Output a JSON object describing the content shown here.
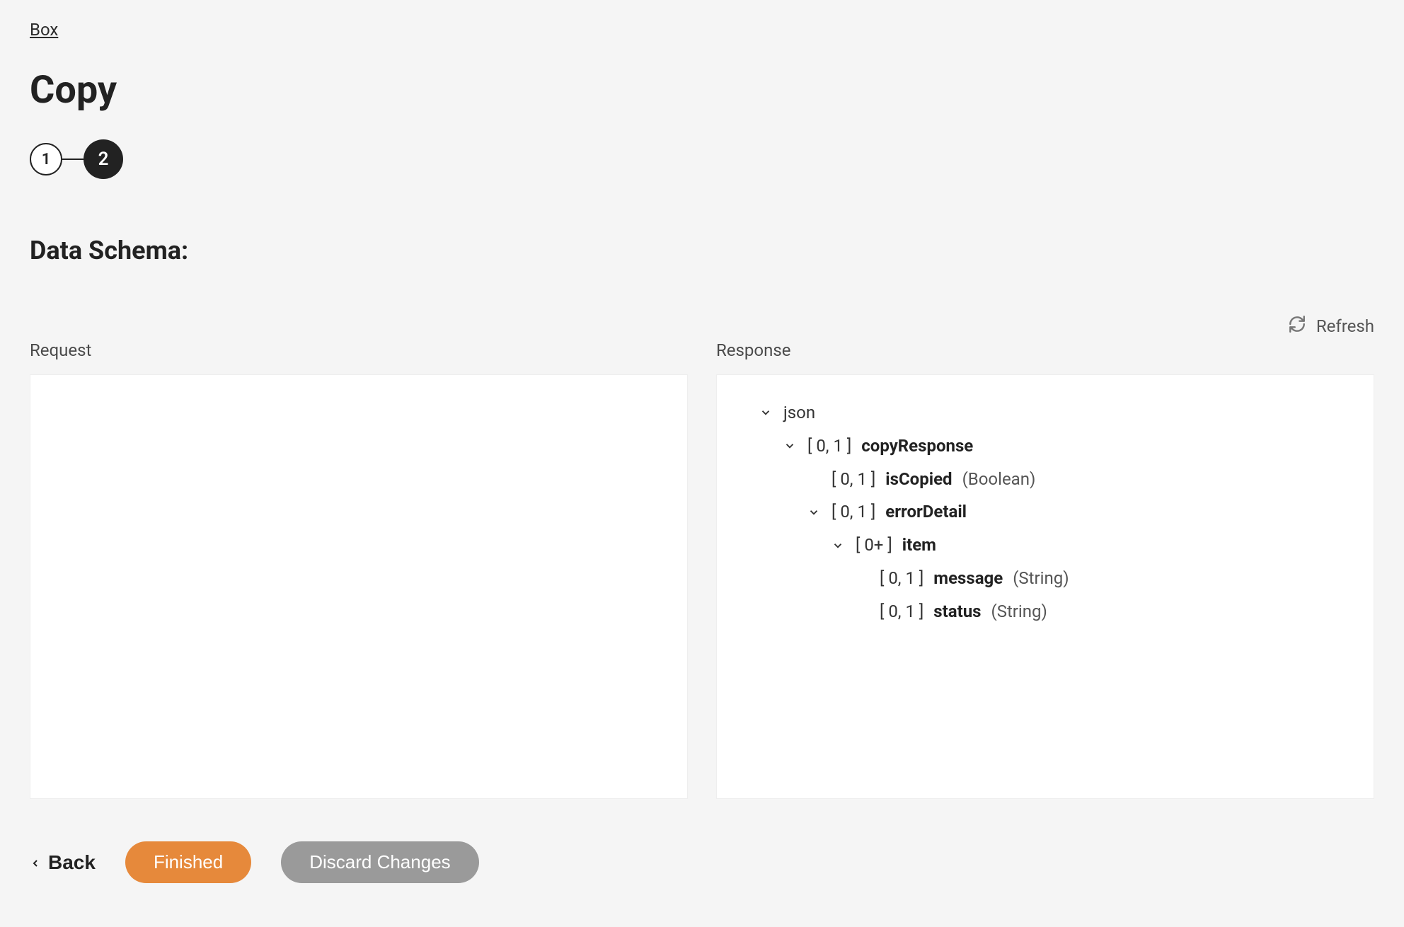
{
  "breadcrumb": {
    "root": "Box"
  },
  "page": {
    "title": "Copy"
  },
  "stepper": {
    "steps": [
      "1",
      "2"
    ],
    "activeIndex": 1
  },
  "section": {
    "title": "Data Schema:"
  },
  "panels": {
    "request": {
      "label": "Request"
    },
    "response": {
      "label": "Response",
      "root": "json",
      "tree": {
        "copyResponse": {
          "card": "[ 0, 1 ]",
          "name": "copyResponse",
          "children": {
            "isCopied": {
              "card": "[ 0, 1 ]",
              "name": "isCopied",
              "type": "(Boolean)"
            },
            "errorDetail": {
              "card": "[ 0, 1 ]",
              "name": "errorDetail",
              "children": {
                "item": {
                  "card": "[ 0+ ]",
                  "name": "item",
                  "children": {
                    "message": {
                      "card": "[ 0, 1 ]",
                      "name": "message",
                      "type": "(String)"
                    },
                    "status": {
                      "card": "[ 0, 1 ]",
                      "name": "status",
                      "type": "(String)"
                    }
                  }
                }
              }
            }
          }
        }
      }
    }
  },
  "controls": {
    "refresh": "Refresh",
    "back": "Back",
    "finished": "Finished",
    "discard": "Discard Changes"
  }
}
